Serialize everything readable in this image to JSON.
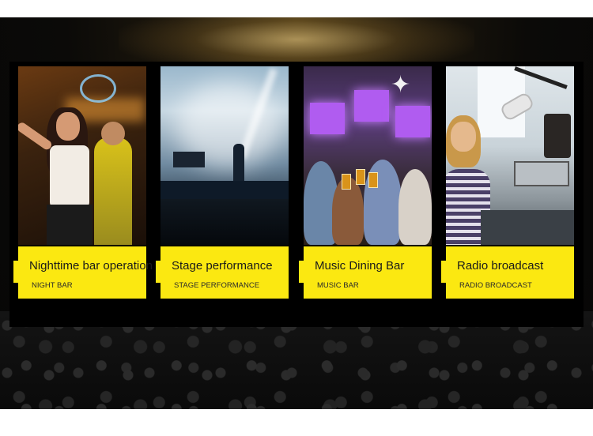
{
  "cards": [
    {
      "title": "Nighttime bar operation",
      "subtitle": "NIGHT BAR"
    },
    {
      "title": "Stage performance",
      "subtitle": "STAGE PERFORMANCE"
    },
    {
      "title": "Music Dining Bar",
      "subtitle": "MUSIC BAR"
    },
    {
      "title": "Radio broadcast",
      "subtitle": "RADIO BROADCAST"
    }
  ],
  "colors": {
    "label_background": "#fbe811",
    "label_text": "#1a1a1a",
    "panel": "#000000"
  }
}
